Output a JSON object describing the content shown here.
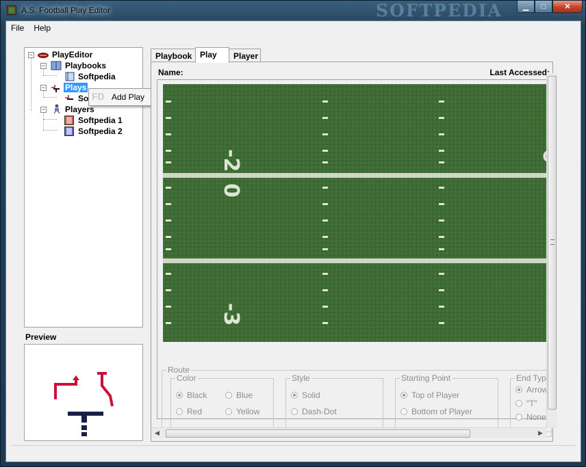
{
  "window": {
    "title": "A.S. Football Play Editor",
    "watermark": "SOFTPEDIA",
    "minimize": "▁",
    "maximize": "□",
    "close": "✕"
  },
  "menubar": {
    "file": "File",
    "help": "Help"
  },
  "tree": {
    "root": "PlayEditor",
    "playbooks": "Playbooks",
    "playbook_item": "Softpedia",
    "plays": "Plays",
    "play_item_partial": "So",
    "players": "Players",
    "player_items": [
      "Softpedia 1",
      "Softpedia 2"
    ]
  },
  "context_menu": {
    "add_play": "Add Play"
  },
  "preview": {
    "label": "Preview"
  },
  "tabs": [
    "Playbook",
    "Play",
    "Player"
  ],
  "play_tab": {
    "name_label": "Name:",
    "last_accessed_label": "Last Accessed:",
    "yard_numbers": [
      "-2",
      "0",
      "-3"
    ]
  },
  "route": {
    "title": "Route",
    "color": {
      "title": "Color",
      "options": [
        "Black",
        "Blue",
        "Red",
        "Yellow"
      ],
      "selected": "Black"
    },
    "style": {
      "title": "Style",
      "options": [
        "Solid",
        "Dash-Dot"
      ],
      "selected": "Solid"
    },
    "starting_point": {
      "title": "Starting Point",
      "options": [
        "Top of Player",
        "Bottom of Player"
      ],
      "selected": "Top of Player"
    },
    "end_type": {
      "title": "End Typ",
      "options": [
        "Arrow",
        "\"T\"",
        "None"
      ],
      "selected": "Arrow"
    }
  },
  "colors": {
    "field_green": "#3e6b34",
    "selection_blue": "#3399ff"
  }
}
